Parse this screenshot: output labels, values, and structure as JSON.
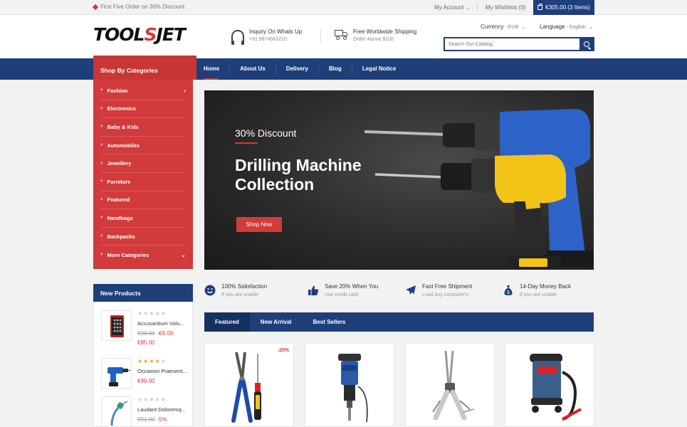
{
  "topbar": {
    "promo_text": "First Five Order on 30% Discount",
    "account_label": "My Account",
    "wishlist_label": "My Wishlists (0)",
    "cart_label": "€305.00 (3 Items)"
  },
  "header": {
    "logo_part1": "TOOL",
    "logo_part2": "S",
    "logo_part3": "JET",
    "feature1_title": "Inquiry On Whats Up",
    "feature1_sub": "+91 9874563210",
    "feature2_title": "Free Worldwide Shipping",
    "feature2_sub": "Order Above $100",
    "currency_label": "Currency",
    "currency_value": "- EUR",
    "language_label": "Language",
    "language_value": "- English",
    "search_placeholder": "Search Our Catalog"
  },
  "nav": {
    "items": [
      "Home",
      "About Us",
      "Delivery",
      "Blog",
      "Legal Notice"
    ]
  },
  "categories": {
    "title": "Shop By Categories",
    "items": [
      "Fashion",
      "Electronics",
      "Baby & Kids",
      "Automobiles",
      "Jewellery",
      "Furniture",
      "Featured",
      "Handbags",
      "Backpacks",
      "More Categories"
    ]
  },
  "new_products": {
    "title": "New Products",
    "items": [
      {
        "name": "Accusantium Volu...",
        "old_price": "€94.00",
        "discount": "-€9.00",
        "price": "€85.00",
        "rating": 0
      },
      {
        "name": "Occasion Praesent...",
        "price": "€99.00",
        "rating": 4
      },
      {
        "name": "Laudant Doloremq...",
        "old_price": "€91.00",
        "discount": "-5%",
        "rating": 0
      }
    ]
  },
  "banner": {
    "discount": "30% Discount",
    "title_line1": "Drilling Machine",
    "title_line2": "Collection",
    "button": "Shop Now"
  },
  "services": [
    {
      "title": "100% Satisfaction",
      "sub": "If you are unable",
      "icon": "smile-icon"
    },
    {
      "title": "Save 20% When You",
      "sub": "Use credit card",
      "icon": "thumbs-up-icon"
    },
    {
      "title": "Fast Free Shipment",
      "sub": "Load any computer's",
      "icon": "plane-icon"
    },
    {
      "title": "14-Day Money Back",
      "sub": "If you are unable",
      "icon": "money-bag-icon"
    }
  ],
  "tabs": [
    "Featured",
    "New Arrival",
    "Best Sellers"
  ],
  "products": [
    {
      "badge": "-20%",
      "image": "pliers-screwdriver"
    },
    {
      "image": "demolition-hammer"
    },
    {
      "image": "multitool"
    },
    {
      "image": "wet-dry-vacuum"
    }
  ],
  "colors": {
    "primary": "#1f3f7b",
    "accent": "#d23b3b"
  }
}
